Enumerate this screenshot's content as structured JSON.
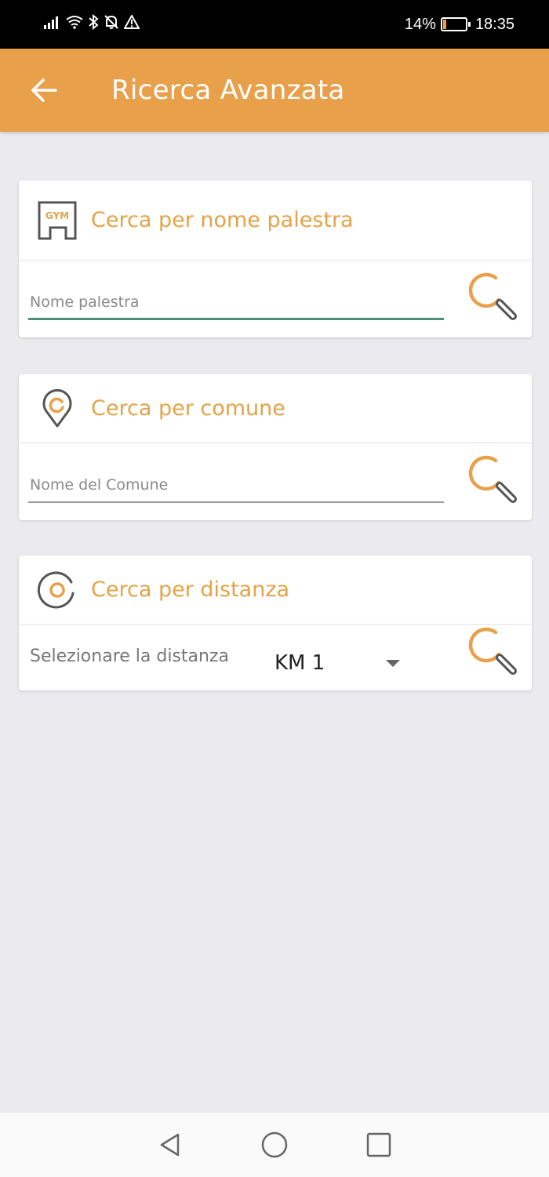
{
  "status_bar": {
    "battery_percent_label": "14%",
    "battery_level": 0.14,
    "time": "18:35"
  },
  "app_bar": {
    "title": "Ricerca Avanzata"
  },
  "cards": {
    "gym": {
      "icon_label": "GYM",
      "title": "Cerca per nome palestra",
      "placeholder": "Nome palestra"
    },
    "comune": {
      "title": "Cerca per comune",
      "placeholder": "Nome del Comune"
    },
    "distanza": {
      "title": "Cerca per distanza",
      "label": "Selezionare la distanza",
      "selected": "KM 1"
    }
  },
  "colors": {
    "accent": "#e8a04a",
    "title": "#e3a347",
    "focus_underline": "#4e8f7a",
    "icon_gray": "#555555"
  }
}
